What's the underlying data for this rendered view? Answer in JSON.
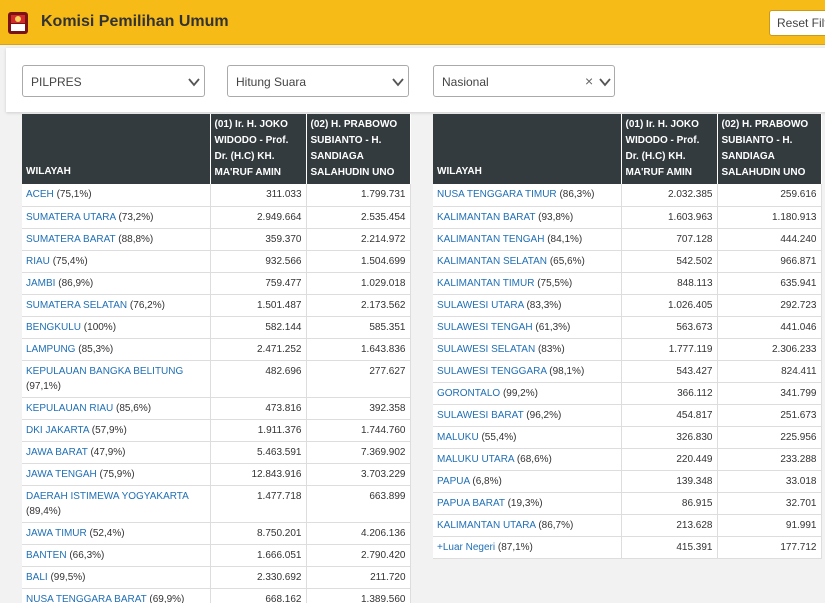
{
  "header": {
    "title": "Komisi Pemilihan Umum",
    "reset_label": "Reset Filter"
  },
  "filters": {
    "election": "PILPRES",
    "mode": "Hitung Suara",
    "scope": "Nasional",
    "clear_glyph": "×"
  },
  "table_headers": {
    "region": "WILAYAH",
    "candidate1": "(01) Ir. H. JOKO WIDODO - Prof. Dr. (H.C) KH. MA'RUF AMIN",
    "candidate2": "(02) H. PRABOWO SUBIANTO - H. SANDIAGA SALAHUDIN UNO"
  },
  "left_rows": [
    {
      "name": "ACEH",
      "pct": "(75,1%)",
      "c1": "311.033",
      "c2": "1.799.731"
    },
    {
      "name": "SUMATERA UTARA",
      "pct": "(73,2%)",
      "c1": "2.949.664",
      "c2": "2.535.454"
    },
    {
      "name": "SUMATERA BARAT",
      "pct": "(88,8%)",
      "c1": "359.370",
      "c2": "2.214.972"
    },
    {
      "name": "RIAU",
      "pct": "(75,4%)",
      "c1": "932.566",
      "c2": "1.504.699"
    },
    {
      "name": "JAMBI",
      "pct": "(86,9%)",
      "c1": "759.477",
      "c2": "1.029.018"
    },
    {
      "name": "SUMATERA SELATAN",
      "pct": "(76,2%)",
      "c1": "1.501.487",
      "c2": "2.173.562"
    },
    {
      "name": "BENGKULU",
      "pct": "(100%)",
      "c1": "582.144",
      "c2": "585.351"
    },
    {
      "name": "LAMPUNG",
      "pct": "(85,3%)",
      "c1": "2.471.252",
      "c2": "1.643.836"
    },
    {
      "name": "KEPULAUAN BANGKA BELITUNG",
      "pct": "(97,1%)",
      "c1": "482.696",
      "c2": "277.627"
    },
    {
      "name": "KEPULAUAN RIAU",
      "pct": "(85,6%)",
      "c1": "473.816",
      "c2": "392.358"
    },
    {
      "name": "DKI JAKARTA",
      "pct": "(57,9%)",
      "c1": "1.911.376",
      "c2": "1.744.760"
    },
    {
      "name": "JAWA BARAT",
      "pct": "(47,9%)",
      "c1": "5.463.591",
      "c2": "7.369.902"
    },
    {
      "name": "JAWA TENGAH",
      "pct": "(75,9%)",
      "c1": "12.843.916",
      "c2": "3.703.229"
    },
    {
      "name": "DAERAH ISTIMEWA YOGYAKARTA",
      "pct": "(89,4%)",
      "c1": "1.477.718",
      "c2": "663.899"
    },
    {
      "name": "JAWA TIMUR",
      "pct": "(52,4%)",
      "c1": "8.750.201",
      "c2": "4.206.136"
    },
    {
      "name": "BANTEN",
      "pct": "(66,3%)",
      "c1": "1.666.051",
      "c2": "2.790.420"
    },
    {
      "name": "BALI",
      "pct": "(99,5%)",
      "c1": "2.330.692",
      "c2": "211.720"
    },
    {
      "name": "NUSA TENGGARA BARAT",
      "pct": "(69,9%)",
      "c1": "668.162",
      "c2": "1.389.560"
    }
  ],
  "right_rows": [
    {
      "name": "NUSA TENGGARA TIMUR",
      "pct": "(86,3%)",
      "c1": "2.032.385",
      "c2": "259.616"
    },
    {
      "name": "KALIMANTAN BARAT",
      "pct": "(93,8%)",
      "c1": "1.603.963",
      "c2": "1.180.913"
    },
    {
      "name": "KALIMANTAN TENGAH",
      "pct": "(84,1%)",
      "c1": "707.128",
      "c2": "444.240"
    },
    {
      "name": "KALIMANTAN SELATAN",
      "pct": "(65,6%)",
      "c1": "542.502",
      "c2": "966.871"
    },
    {
      "name": "KALIMANTAN TIMUR",
      "pct": "(75,5%)",
      "c1": "848.113",
      "c2": "635.941"
    },
    {
      "name": "SULAWESI UTARA",
      "pct": "(83,3%)",
      "c1": "1.026.405",
      "c2": "292.723"
    },
    {
      "name": "SULAWESI TENGAH",
      "pct": "(61,3%)",
      "c1": "563.673",
      "c2": "441.046"
    },
    {
      "name": "SULAWESI SELATAN",
      "pct": "(83%)",
      "c1": "1.777.119",
      "c2": "2.306.233"
    },
    {
      "name": "SULAWESI TENGGARA",
      "pct": "(98,1%)",
      "c1": "543.427",
      "c2": "824.411"
    },
    {
      "name": "GORONTALO",
      "pct": "(99,2%)",
      "c1": "366.112",
      "c2": "341.799"
    },
    {
      "name": "SULAWESI BARAT",
      "pct": "(96,2%)",
      "c1": "454.817",
      "c2": "251.673"
    },
    {
      "name": "MALUKU",
      "pct": "(55,4%)",
      "c1": "326.830",
      "c2": "225.956"
    },
    {
      "name": "MALUKU UTARA",
      "pct": "(68,6%)",
      "c1": "220.449",
      "c2": "233.288"
    },
    {
      "name": "PAPUA",
      "pct": "(6,8%)",
      "c1": "139.348",
      "c2": "33.018"
    },
    {
      "name": "PAPUA BARAT",
      "pct": "(19,3%)",
      "c1": "86.915",
      "c2": "32.701"
    },
    {
      "name": "KALIMANTAN UTARA",
      "pct": "(86,7%)",
      "c1": "213.628",
      "c2": "91.991"
    },
    {
      "name": "+Luar Negeri",
      "pct": "(87,1%)",
      "c1": "415.391",
      "c2": "177.712"
    }
  ]
}
